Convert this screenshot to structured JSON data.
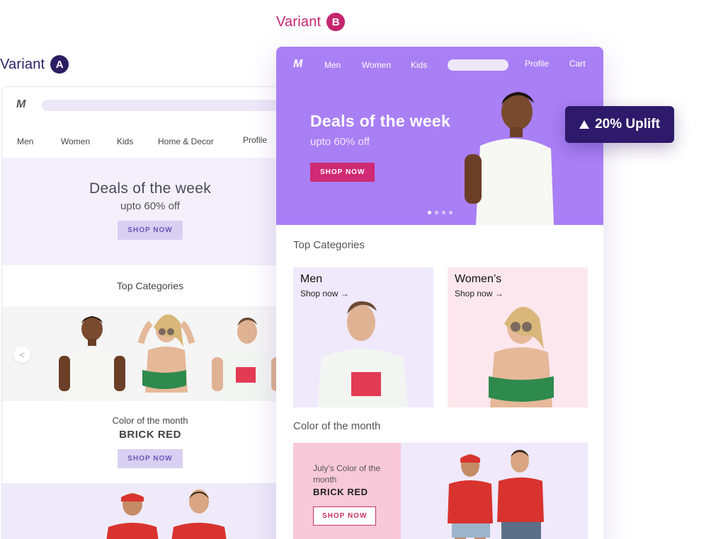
{
  "variant_a": {
    "label": "Variant",
    "badge": "A",
    "logo": "M",
    "nav": [
      "Men",
      "Women",
      "Kids",
      "Home & Decor",
      "Profile"
    ],
    "hero": {
      "title": "Deals of the week",
      "subtitle": "upto 60% off",
      "button": "SHOP NOW"
    },
    "categories": {
      "title": "Top Categories",
      "prev_glyph": "<"
    },
    "color_of_month": {
      "line1": "Color of the month",
      "line2": "BRICK RED",
      "button": "SHOP NOW"
    }
  },
  "variant_b": {
    "label": "Variant",
    "badge": "B",
    "logo": "M",
    "nav": [
      "Men",
      "Women",
      "Kids",
      "Profile",
      "Cart"
    ],
    "hero": {
      "title": "Deals of the week",
      "subtitle": "upto 60% off",
      "button": "SHOP NOW"
    },
    "categories_title": "Top Categories",
    "cards": [
      {
        "title": "Men",
        "link": "Shop now →",
        "bg": "#efe9fb"
      },
      {
        "title": "Women’s",
        "link": "Shop now →",
        "bg": "#fde7ee"
      }
    ],
    "color_section_title": "Color of the month",
    "color_card": {
      "line1": "July’s Color of the month",
      "line2": "BRICK RED",
      "button": "SHOP NOW"
    }
  },
  "uplift": {
    "text": "20% Uplift",
    "icon": "triangle-up-icon"
  },
  "colors": {
    "variant_a_accent": "#2c1e63",
    "variant_b_accent": "#c4266f",
    "hero_purple": "#a97ff5",
    "shop_pink": "#cf2a73",
    "brick_red": "#d9332f"
  }
}
